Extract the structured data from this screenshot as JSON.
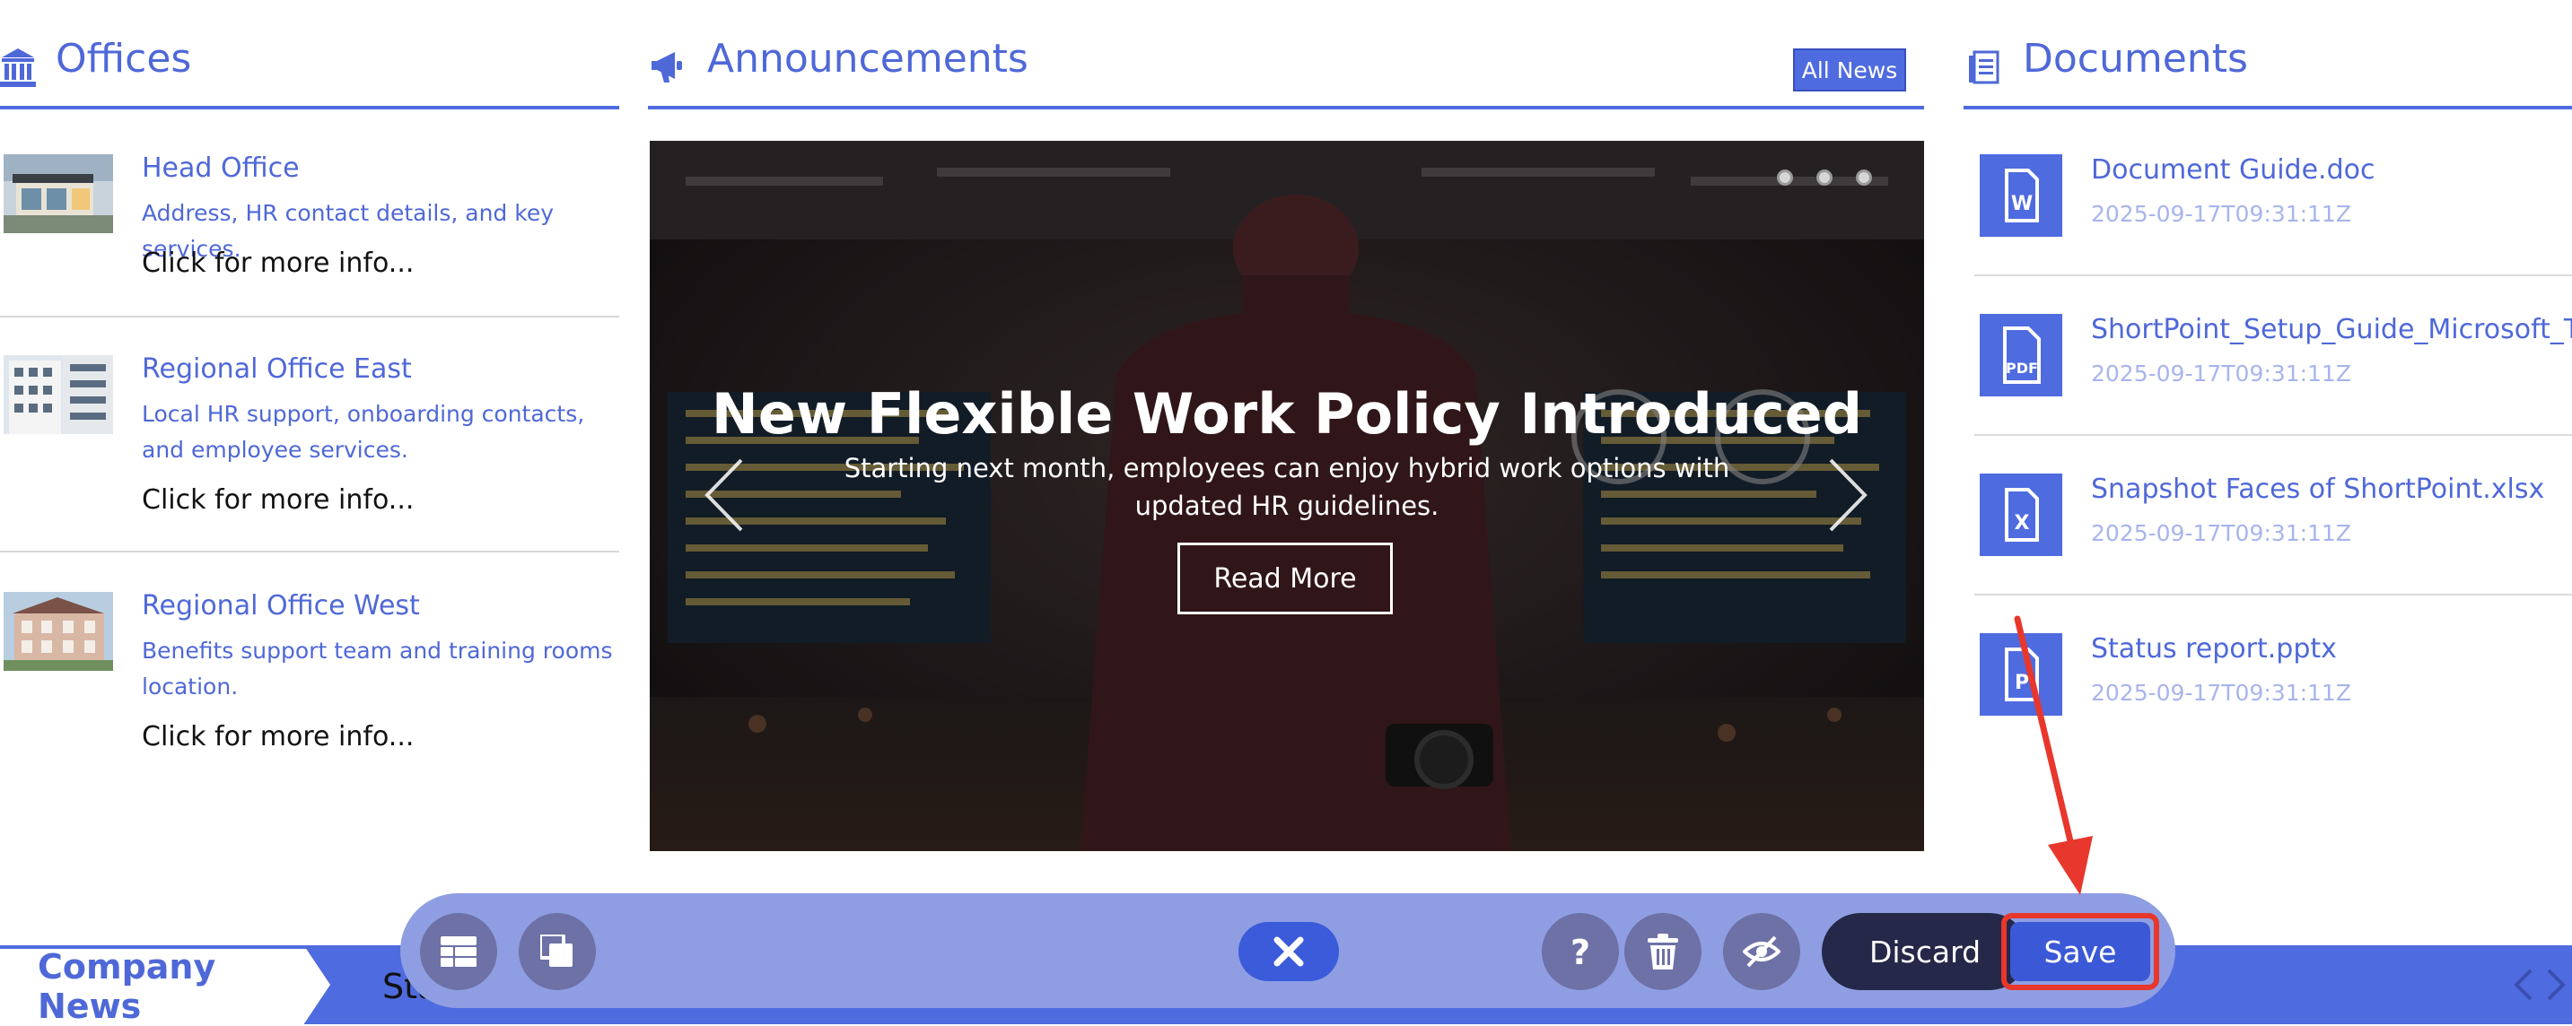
{
  "offices": {
    "title": "Offices",
    "icon": "bank-icon",
    "items": [
      {
        "name": "Head Office",
        "desc": "Address, HR contact details, and key services.",
        "more": "Click for more info..."
      },
      {
        "name": "Regional Office East",
        "desc": "Local HR support, onboarding contacts, and employee services.",
        "more": "Click for more info..."
      },
      {
        "name": "Regional Office West",
        "desc": "Benefits support team and training rooms location.",
        "more": "Click for more info..."
      }
    ]
  },
  "announcements": {
    "title": "Announcements",
    "icon": "megaphone-icon",
    "all_news": "All News",
    "slide": {
      "title": "New Flexible Work Policy Introduced",
      "subtitle": "Starting next month, employees can enjoy hybrid work options with updated HR guidelines.",
      "button": "Read More"
    },
    "slide_count": 3
  },
  "documents": {
    "title": "Documents",
    "icon": "document-list-icon",
    "items": [
      {
        "name": "Document Guide.doc",
        "date": "2025-09-17T09:31:11Z",
        "icon": "word-doc-icon"
      },
      {
        "name": "ShortPoint_Setup_Guide_Microsoft_Tear",
        "date": "2025-09-17T09:31:11Z",
        "icon": "pdf-icon"
      },
      {
        "name": "Snapshot Faces of ShortPoint.xlsx",
        "date": "2025-09-17T09:31:11Z",
        "icon": "excel-icon"
      },
      {
        "name": "Status report.pptx",
        "date": "2025-09-17T09:31:11Z",
        "icon": "powerpoint-icon"
      }
    ]
  },
  "ticker": {
    "label": "Company News",
    "text": "Sta"
  },
  "toolbar": {
    "discard": "Discard",
    "save": "Save"
  },
  "colors": {
    "accent": "#4f6be0",
    "link": "#4f68d8",
    "toolbar_bg": "#8f9ee2",
    "highlight": "#e8372c"
  }
}
